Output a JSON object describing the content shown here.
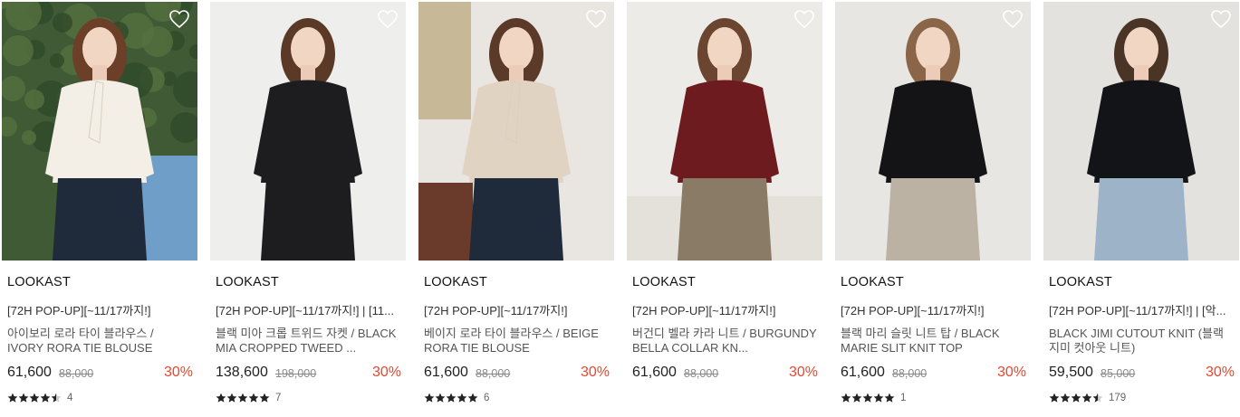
{
  "products": [
    {
      "brand": "LOOKAST",
      "tag": "[72H POP-UP][~11/17까지!]",
      "name": "아이보리 로라 타이 블라우스 / IVORY RORA TIE BLOUSE",
      "price": "61,600",
      "original_price": "88,000",
      "discount": "30%",
      "rating": 4.5,
      "review_count": "4",
      "image_desc": "ivory tie blouse, outdoor greenery",
      "colors": {
        "bg": "#3f5a35",
        "garment": "#f3efe6",
        "hair": "#6b3f28"
      }
    },
    {
      "brand": "LOOKAST",
      "tag": "[72H POP-UP][~11/17까지!] | [11...",
      "name": "블랙 미아 크롭 트위드 자켓 / BLACK MIA CROPPED TWEED ...",
      "price": "138,600",
      "original_price": "198,000",
      "discount": "30%",
      "rating": 5,
      "review_count": "7",
      "colors": {
        "bg": "#eeeeec",
        "garment": "#1d1d1f",
        "hair": "#5a3a26"
      }
    },
    {
      "brand": "LOOKAST",
      "tag": "[72H POP-UP][~11/17까지!]",
      "name": "베이지 로라 타이 블라우스 / BEIGE RORA TIE BLOUSE",
      "price": "61,600",
      "original_price": "88,000",
      "discount": "30%",
      "rating": 5,
      "review_count": "6",
      "colors": {
        "bg": "#e9e6e1",
        "garment": "#e1d3c1",
        "hair": "#5b3a29"
      }
    },
    {
      "brand": "LOOKAST",
      "tag": "[72H POP-UP][~11/17까지!]",
      "name": "버건디 벨라 카라 니트 / BURGUNDY BELLA COLLAR KN...",
      "price": "61,600",
      "original_price": "88,000",
      "discount": "30%",
      "rating": 0,
      "review_count": "",
      "colors": {
        "bg": "#ecebe8",
        "garment": "#6d1b1e",
        "hair": "#6b4530"
      }
    },
    {
      "brand": "LOOKAST",
      "tag": "[72H POP-UP][~11/17까지!]",
      "name": "블랙 마리 슬릿 니트 탑 / BLACK MARIE SLIT KNIT TOP",
      "price": "61,600",
      "original_price": "88,000",
      "discount": "30%",
      "rating": 5,
      "review_count": "1",
      "colors": {
        "bg": "#e8e6e2",
        "garment": "#141416",
        "hair": "#8a6548"
      }
    },
    {
      "brand": "LOOKAST",
      "tag": "[72H POP-UP][~11/17까지!] | [악...",
      "name": "BLACK JIMI CUTOUT KNIT (블랙 지미 컷아웃 니트)",
      "price": "59,500",
      "original_price": "85,000",
      "discount": "30%",
      "rating": 4.5,
      "review_count": "179",
      "colors": {
        "bg": "#e4e2de",
        "garment": "#121417",
        "hair": "#4a3426"
      }
    }
  ],
  "accent": {
    "discount": "#e8472f",
    "star": "#222222"
  },
  "icons": {
    "wishlist": "heart-outline-icon",
    "star": "star-icon"
  }
}
